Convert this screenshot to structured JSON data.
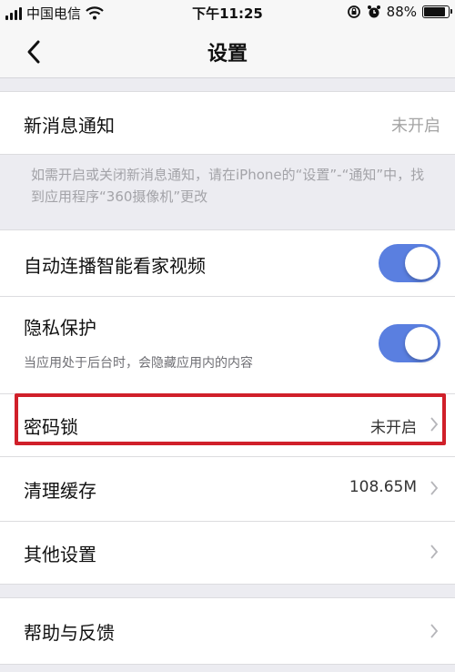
{
  "status_bar": {
    "carrier": "中国电信",
    "time": "下午11:25",
    "battery": "88%",
    "battery_level": 0.88
  },
  "nav": {
    "title": "设置"
  },
  "rows": {
    "notification": {
      "label": "新消息通知",
      "value": "未开启"
    },
    "notification_note": "如需开启或关闭新消息通知，请在iPhone的“设置”-“通知”中，找到应用程序“360摄像机”更改",
    "autoplay": {
      "label": "自动连播智能看家视频",
      "toggle": "on"
    },
    "privacy": {
      "label": "隐私保护",
      "subtext": "当应用处于后台时，会隐藏应用内的内容",
      "toggle": "on"
    },
    "passcode": {
      "label": "密码锁",
      "value": "未开启"
    },
    "cache": {
      "label": "清理缓存",
      "value": "108.65M"
    },
    "other": {
      "label": "其他设置"
    },
    "help": {
      "label": "帮助与反馈"
    }
  },
  "colors": {
    "toggle_on": "#5a7fe0",
    "highlight": "#d0202a",
    "background": "#ececf1"
  },
  "icons": {
    "back": "chevron-left-icon",
    "disclosure": "chevron-right-icon",
    "wifi": "wifi-icon",
    "lock_rotation": "rotation-lock-icon",
    "alarm": "alarm-icon"
  }
}
